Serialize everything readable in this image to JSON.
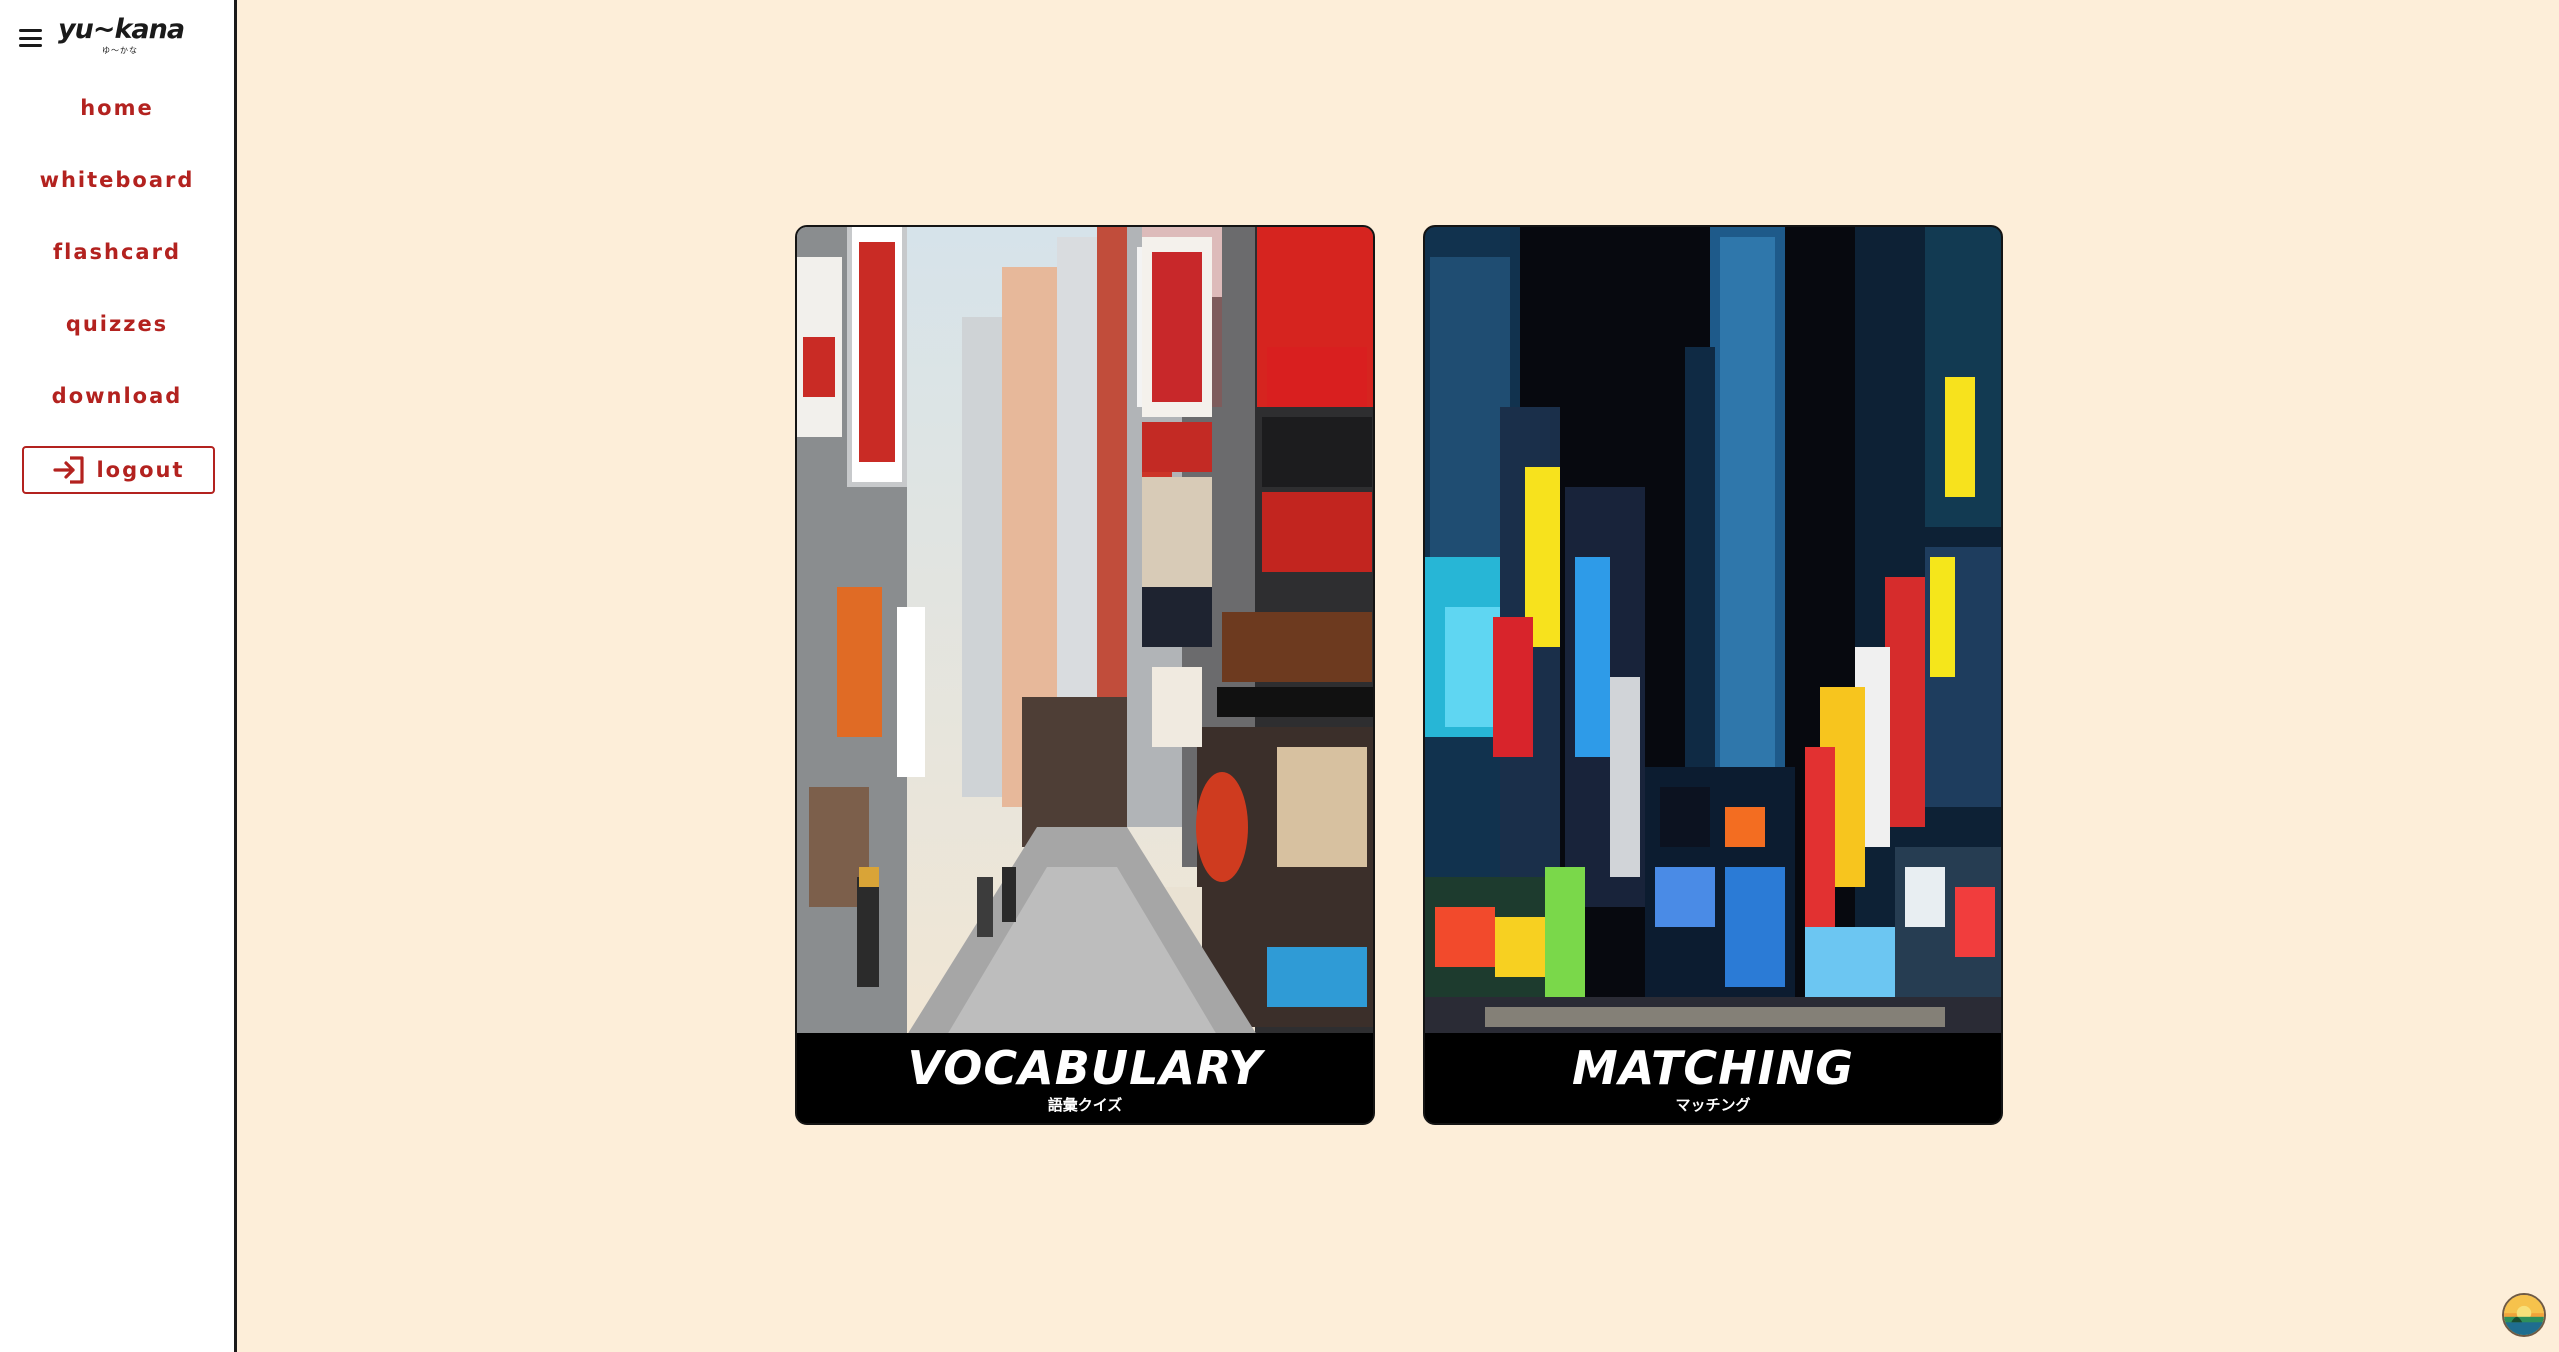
{
  "sidebar": {
    "logo": {
      "text": "yu~kana",
      "sub": "ゆ〜かな"
    },
    "menu_icon": "hamburger-menu-icon",
    "nav": [
      {
        "label": "home"
      },
      {
        "label": "whiteboard"
      },
      {
        "label": "flashcard"
      },
      {
        "label": "quizzes"
      },
      {
        "label": "download"
      }
    ],
    "logout": {
      "label": "logout",
      "icon": "login-arrow-icon"
    }
  },
  "main": {
    "cards": [
      {
        "title": "VOCABULARY",
        "subtitle": "語彙クイズ"
      },
      {
        "title": "MATCHING",
        "subtitle": "マッチング"
      }
    ]
  },
  "corner_button": {
    "icon": "sunset-avatar-icon"
  },
  "colors": {
    "background": "#fdeed9",
    "accent": "#b3221f",
    "sidebar": "#ffffff",
    "card_banner": "#000000"
  }
}
